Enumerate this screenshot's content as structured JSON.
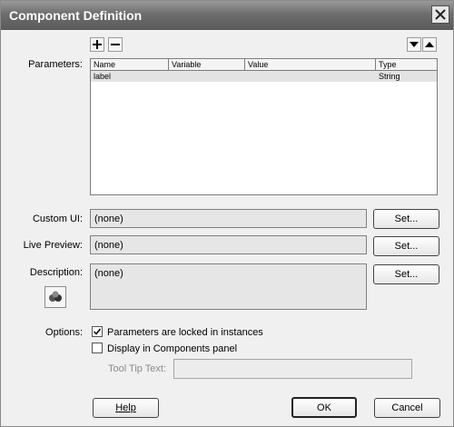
{
  "window": {
    "title": "Component Definition"
  },
  "toolbar": {
    "add_icon": "plus-icon",
    "remove_icon": "minus-icon",
    "down_icon": "triangle-down-icon",
    "up_icon": "triangle-up-icon"
  },
  "parameters": {
    "label": "Parameters:",
    "columns": [
      "Name",
      "Variable",
      "Value",
      "Type"
    ],
    "rows": [
      {
        "name": "label",
        "variable": "",
        "value": "",
        "type": "String"
      }
    ]
  },
  "custom_ui": {
    "label": "Custom UI:",
    "value": "(none)",
    "button": "Set..."
  },
  "live_preview": {
    "label": "Live Preview:",
    "value": "(none)",
    "button": "Set..."
  },
  "description": {
    "label": "Description:",
    "value": "(none)",
    "button": "Set...",
    "icon": "component-icon"
  },
  "options": {
    "label": "Options:",
    "locked": {
      "label": "Parameters are locked in instances",
      "checked": true
    },
    "display": {
      "label": "Display in Components panel",
      "checked": false
    },
    "tooltip": {
      "label": "Tool Tip Text:",
      "value": ""
    }
  },
  "buttons": {
    "help": "Help",
    "ok": "OK",
    "cancel": "Cancel"
  }
}
